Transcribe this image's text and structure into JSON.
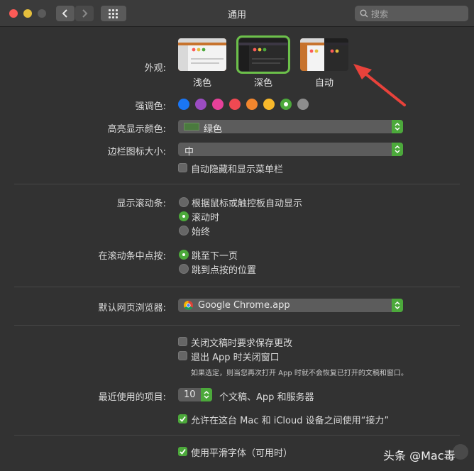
{
  "window": {
    "title": "通用"
  },
  "search": {
    "placeholder": "搜索"
  },
  "appearance": {
    "label": "外观:",
    "options": [
      {
        "name": "浅色"
      },
      {
        "name": "深色",
        "selected": true
      },
      {
        "name": "自动"
      }
    ]
  },
  "accent": {
    "label": "强调色:",
    "colors": [
      "#1a76f5",
      "#9b4cc2",
      "#e6419a",
      "#ef4952",
      "#f2862e",
      "#f8b92b",
      "#4ca93b",
      "#8d8d8d"
    ],
    "selected_index": 6
  },
  "highlight": {
    "label": "高亮显示颜色:",
    "value": "绿色",
    "swatch": "#4a7a3e"
  },
  "sidebar_icon_size": {
    "label": "边栏图标大小:",
    "value": "中"
  },
  "auto_hide_menu": {
    "label": "自动隐藏和显示菜单栏",
    "checked": false
  },
  "scrollbars": {
    "label": "显示滚动条:",
    "options": [
      {
        "text": "根据鼠标或触控板自动显示",
        "selected": false
      },
      {
        "text": "滚动时",
        "selected": true
      },
      {
        "text": "始终",
        "selected": false
      }
    ]
  },
  "click_scroll": {
    "label": "在滚动条中点按:",
    "options": [
      {
        "text": "跳至下一页",
        "selected": true
      },
      {
        "text": "跳到点按的位置",
        "selected": false
      }
    ]
  },
  "browser": {
    "label": "默认网页浏览器:",
    "value": "Google Chrome.app"
  },
  "close_docs": {
    "label": "关闭文稿时要求保存更改",
    "checked": false
  },
  "quit_app": {
    "label": "退出 App 时关闭窗口",
    "checked": false
  },
  "quit_note": "如果选定，则当您再次打开 App 时就不会恢复已打开的文稿和窗口。",
  "recent": {
    "label": "最近使用的项目:",
    "value": "10",
    "suffix": "个文稿、App 和服务器"
  },
  "handoff": {
    "label": "允许在这台 Mac 和 iCloud 设备之间使用“接力”",
    "checked": true
  },
  "font_smoothing": {
    "label": "使用平滑字体（可用时）",
    "checked": true
  },
  "watermark": "头条 @Mac毒",
  "colors": {
    "accent_green": "#4ca93b",
    "arrow_red": "#e8423b"
  }
}
